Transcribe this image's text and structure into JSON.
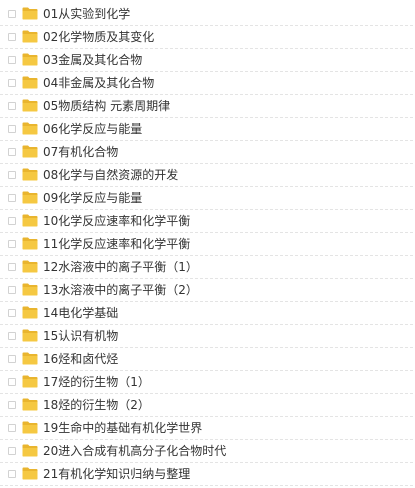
{
  "colors": {
    "folder": "#f5c842",
    "folder_tab": "#e9b52f",
    "text": "#333333",
    "divider": "#e4e4e4"
  },
  "icons": {
    "checkbox": "checkbox-icon",
    "folder": "folder-icon"
  },
  "folders": [
    "01从实验到化学",
    "02化学物质及其变化",
    "03金属及其化合物",
    "04非金属及其化合物",
    "05物质结构 元素周期律",
    "06化学反应与能量",
    "07有机化合物",
    "08化学与自然资源的开发",
    "09化学反应与能量",
    "10化学反应速率和化学平衡",
    "11化学反应速率和化学平衡",
    "12水溶液中的离子平衡（1）",
    "13水溶液中的离子平衡（2）",
    "14电化学基础",
    "15认识有机物",
    "16烃和卤代烃",
    "17烃的衍生物（1）",
    "18烃的衍生物（2）",
    "19生命中的基础有机化学世界",
    "20进入合成有机高分子化合物时代",
    "21有机化学知识归纳与整理"
  ]
}
